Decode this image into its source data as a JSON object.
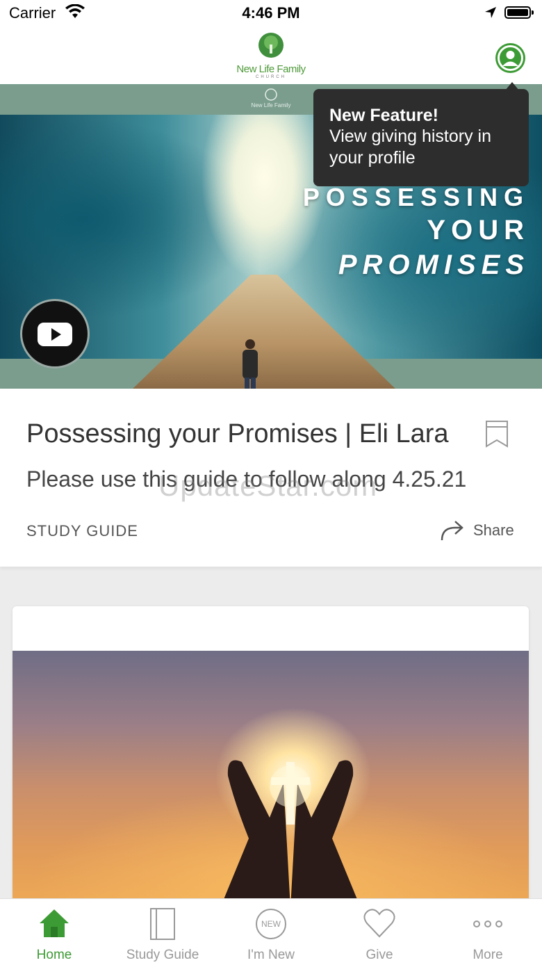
{
  "status_bar": {
    "carrier": "Carrier",
    "time": "4:46 PM"
  },
  "header": {
    "logo_text": "New Life Family",
    "logo_sub": "CHURCH"
  },
  "tooltip": {
    "title": "New Feature!",
    "body_line1": "View giving history in",
    "body_line2": "your profile"
  },
  "hero": {
    "mini_logo": "New Life Family",
    "title_line1": "POSSESSING",
    "title_line2": "YOUR",
    "title_line3": "PROMISES"
  },
  "featured": {
    "title": "Possessing your Promises | Eli Lara",
    "description": "Please use this guide to follow along 4.25.21",
    "category": "STUDY GUIDE",
    "share_label": "Share",
    "watermark": "UpdateStar.com"
  },
  "tabs": [
    {
      "label": "Home",
      "icon": "home-icon",
      "active": true
    },
    {
      "label": "Study Guide",
      "icon": "book-icon",
      "active": false
    },
    {
      "label": "I'm New",
      "icon": "new-badge-icon",
      "active": false
    },
    {
      "label": "Give",
      "icon": "heart-icon",
      "active": false
    },
    {
      "label": "More",
      "icon": "more-dots-icon",
      "active": false
    }
  ],
  "colors": {
    "accent": "#3d9b35",
    "tooltip_bg": "#2d2d2d",
    "hero_band": "#7a9d8e"
  }
}
